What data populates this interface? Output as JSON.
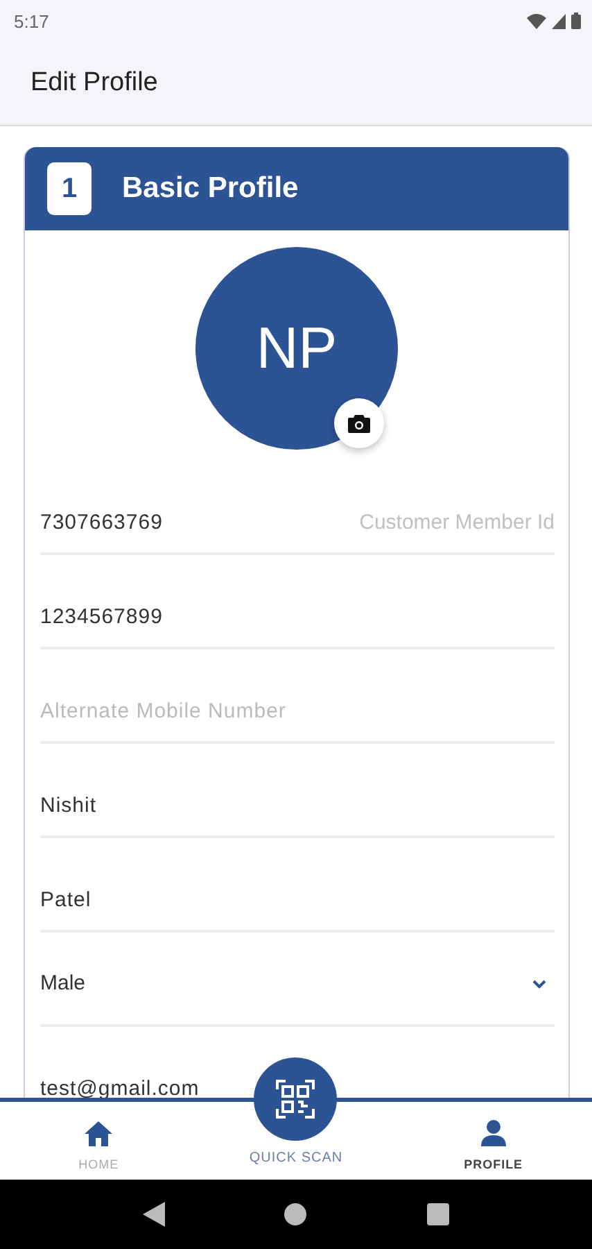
{
  "status_bar": {
    "time": "5:17"
  },
  "app_bar": {
    "title": "Edit Profile"
  },
  "section": {
    "number": "1",
    "title": "Basic Profile"
  },
  "avatar": {
    "initials": "NP"
  },
  "fields": [
    {
      "kind": "text",
      "value": "7307663769",
      "label": "Customer Member Id"
    },
    {
      "kind": "text",
      "value": "1234567899"
    },
    {
      "kind": "text",
      "placeholder": "Alternate Mobile Number"
    },
    {
      "kind": "text",
      "value": "Nishit"
    },
    {
      "kind": "text",
      "value": "Patel"
    },
    {
      "kind": "select",
      "value": "Male"
    },
    {
      "kind": "text",
      "value": "test@gmail.com"
    }
  ],
  "bottom_nav": [
    {
      "kind": "home",
      "label": "HOME",
      "selected": false
    },
    {
      "kind": "scan",
      "label": "QUICK SCAN",
      "selected": false
    },
    {
      "kind": "profile",
      "label": "PROFILE",
      "selected": true
    }
  ]
}
